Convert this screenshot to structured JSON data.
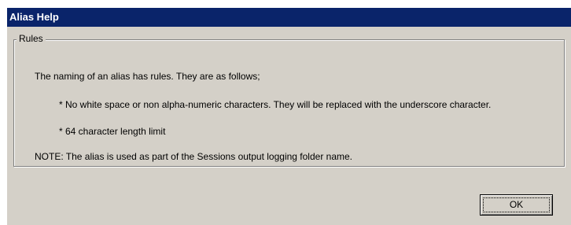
{
  "window": {
    "title": "Alias Help"
  },
  "rules": {
    "group_label": "Rules",
    "intro": "The naming of an alias has rules. They are as follows;",
    "bullets": [
      "*  No white space or non alpha-numeric characters. They will be replaced with the underscore character.",
      "*  64 character length limit"
    ],
    "note": "NOTE: The alias is used as part of the Sessions output logging folder name."
  },
  "buttons": {
    "ok_label": "OK"
  },
  "colors": {
    "titlebar": "#0a246a",
    "dialog_face": "#d4d0c8"
  }
}
